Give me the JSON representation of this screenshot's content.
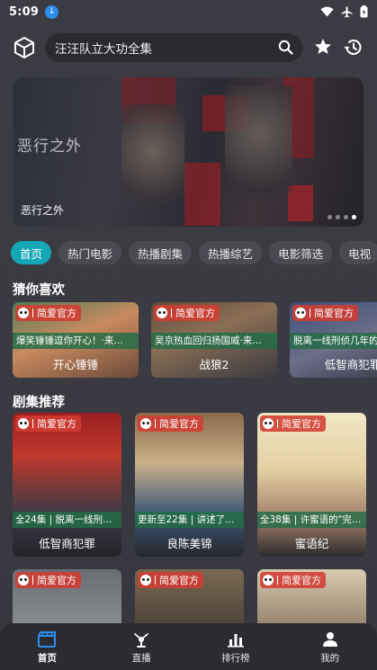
{
  "status_bar": {
    "time": "5:09"
  },
  "header": {
    "search_text": "汪汪队立大功全集",
    "icons": [
      "box-icon",
      "search-icon",
      "star-icon",
      "history-icon"
    ]
  },
  "banner": {
    "title": "恶行之外",
    "watermark": "恶行之外",
    "dots": 4,
    "active_dot": 3
  },
  "tabs": [
    "首页",
    "热门电影",
    "热播剧集",
    "热播综艺",
    "电影筛选",
    "电视"
  ],
  "active_tab": "首页",
  "sections": {
    "guess": {
      "title": "猜你喜欢",
      "items": [
        {
          "badge": "简爱官方",
          "desc": "爆笑锤锤逗你开心！·来…",
          "name": "开心锤锤"
        },
        {
          "badge": "简爱官方",
          "desc": "吴京热血回归扬国威·来…",
          "name": "战狼2"
        },
        {
          "badge": "简爱官方",
          "desc": "脱离一线刑侦几年的",
          "name": "低智商犯罪"
        }
      ]
    },
    "drama": {
      "title": "剧集推荐",
      "items": [
        {
          "badge": "简爱官方",
          "desc": "全24集 | 脱离一线刑…",
          "name": "低智商犯罪"
        },
        {
          "badge": "简爱官方",
          "desc": "更新至22集 | 讲述了…",
          "name": "良陈美锦"
        },
        {
          "badge": "简爱官方",
          "desc": "全38集 | 许蜜语的\"完…",
          "name": "蜜语纪"
        }
      ],
      "more_items": [
        {
          "badge": "简爱官方"
        },
        {
          "badge": "简爱官方"
        },
        {
          "badge": "简爱官方"
        }
      ]
    }
  },
  "bottom_nav": [
    {
      "label": "首页",
      "icon": "clapperboard-icon",
      "active": true
    },
    {
      "label": "直播",
      "icon": "live-icon",
      "active": false
    },
    {
      "label": "排行榜",
      "icon": "chart-icon",
      "active": false
    },
    {
      "label": "我的",
      "icon": "person-icon",
      "active": false
    }
  ],
  "colors": {
    "accent": "#16a7b6",
    "badge": "#d23c32",
    "desc_bar": "#226e46"
  }
}
